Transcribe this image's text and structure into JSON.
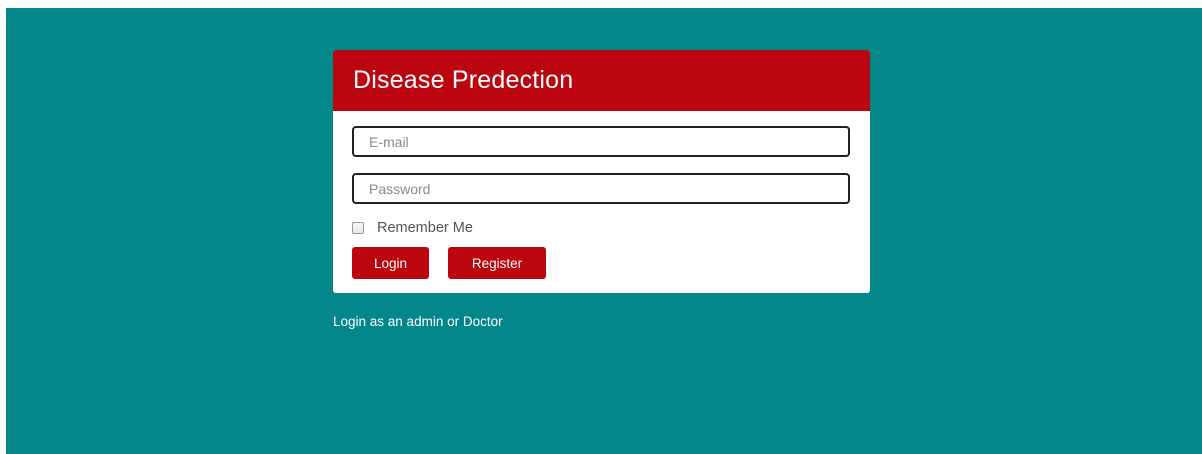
{
  "panel": {
    "title": "Disease Predection"
  },
  "form": {
    "email_placeholder": "E-mail",
    "password_placeholder": "Password",
    "remember_label": "Remember Me",
    "remember_checked": false,
    "login_label": "Login",
    "register_label": "Register"
  },
  "footer": {
    "admin_link": "Login as an admin or Doctor"
  },
  "colors": {
    "background": "#03878b",
    "accent": "#bb0610",
    "panel": "#ffffff"
  }
}
